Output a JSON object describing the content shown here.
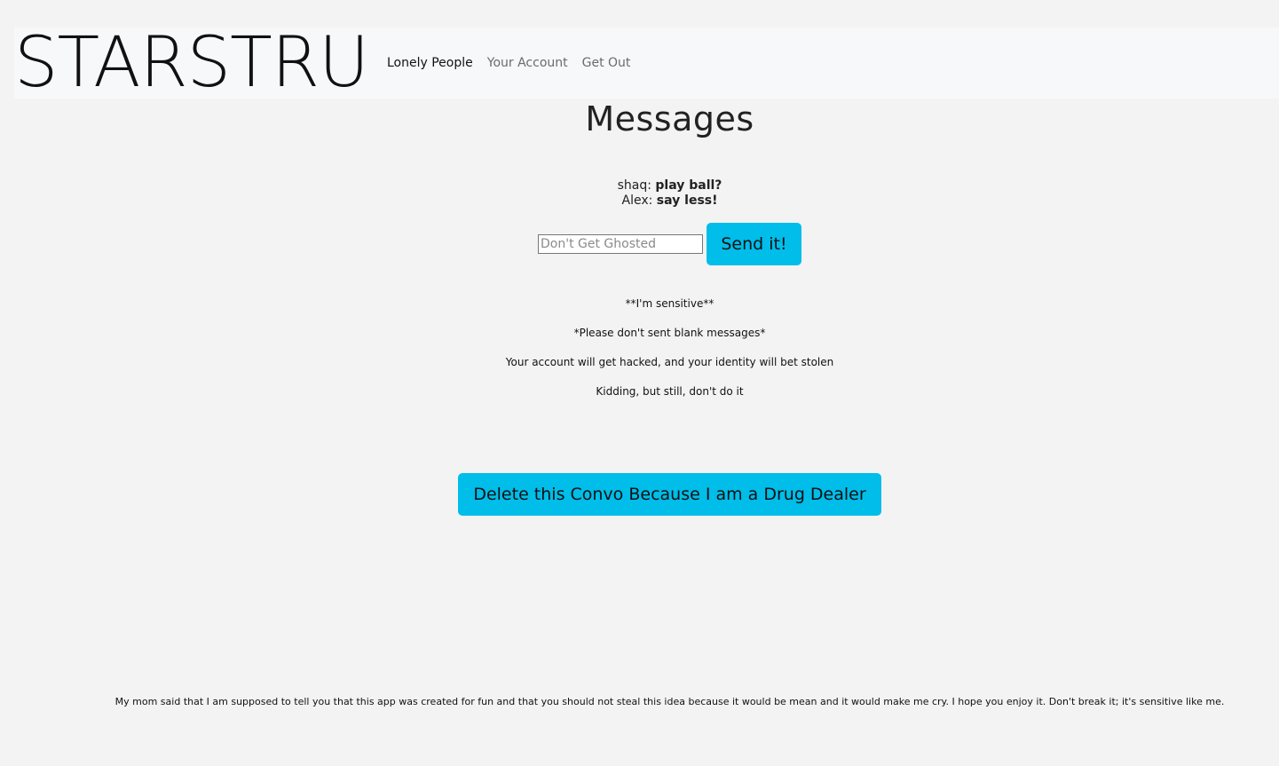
{
  "nav": {
    "brand": "STARSTRUC",
    "links": [
      "Lonely People",
      "Your Account",
      "Get Out"
    ]
  },
  "page": {
    "title": "Messages"
  },
  "messages": [
    {
      "sender": "shaq:",
      "text": "play ball?"
    },
    {
      "sender": "Alex:",
      "text": "say less!"
    }
  ],
  "compose": {
    "placeholder": "Don't Get Ghosted",
    "value": "",
    "send_label": "Send it!"
  },
  "notes": [
    "**I'm sensitive**",
    "*Please don't sent blank messages*",
    "Your account will get hacked, and your identity will bet stolen",
    "Kidding, but still, don't do it"
  ],
  "delete_label": "Delete this Convo Because I am a Drug Dealer",
  "footer": "My mom said that I am supposed to tell you that this app was created for fun and that you should not steal this idea because it would be mean and it would make me cry. I hope you enjoy it. Don't break it; it's sensitive like me.",
  "colors": {
    "button": "#00bde9",
    "background": "#f3f3f3",
    "navbar": "#f7f8fa"
  }
}
